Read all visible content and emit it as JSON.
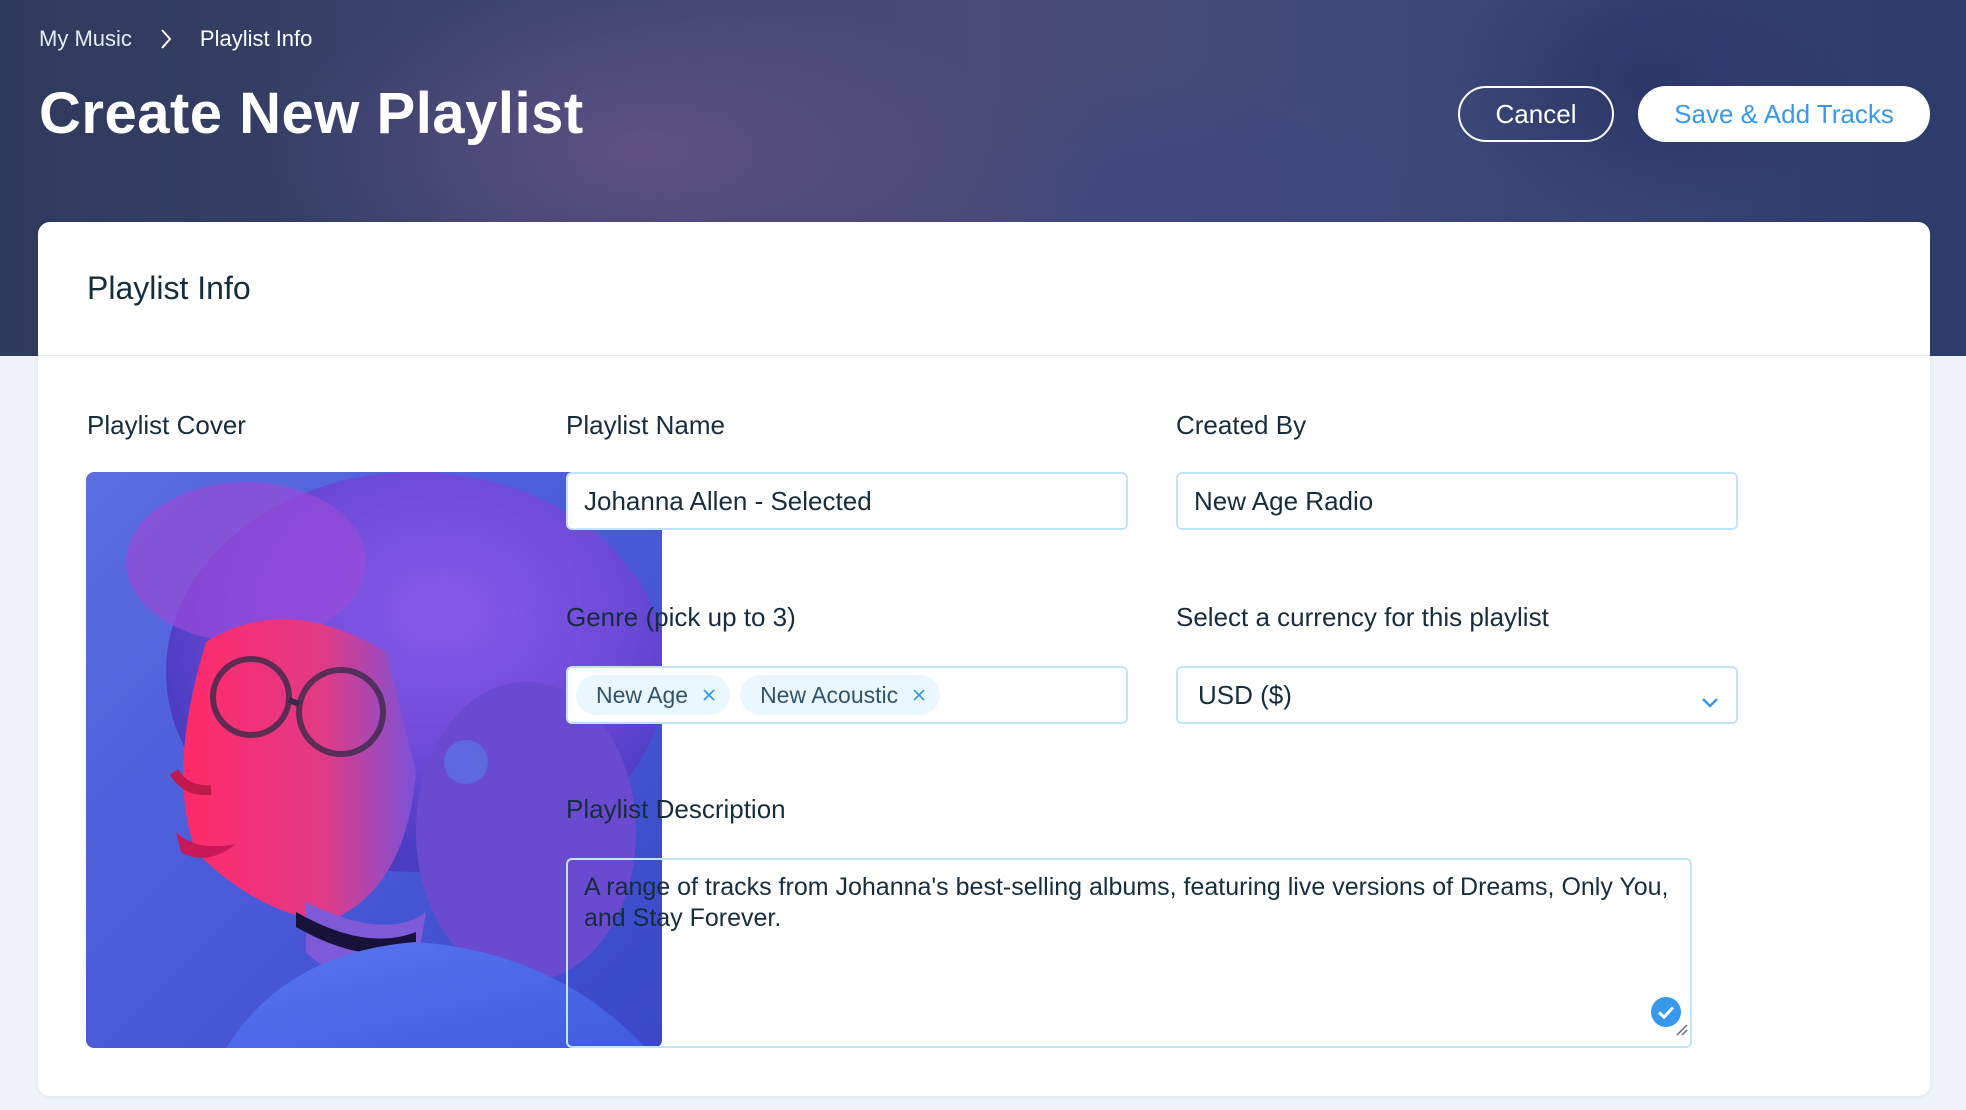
{
  "breadcrumb": {
    "parent": "My Music",
    "current": "Playlist Info",
    "separator_icon": "chevron-right-icon"
  },
  "header": {
    "title": "Create New Playlist",
    "cancel_label": "Cancel",
    "save_label": "Save & Add Tracks"
  },
  "card": {
    "title": "Playlist Info"
  },
  "form": {
    "cover": {
      "label": "Playlist Cover",
      "icon": "playlist-cover-image"
    },
    "playlist_name": {
      "label": "Playlist Name",
      "value": "Johanna Allen - Selected"
    },
    "created_by": {
      "label": "Created By",
      "value": "New Age Radio"
    },
    "genre": {
      "label": "Genre (pick up to 3)",
      "tags": [
        {
          "label": "New Age"
        },
        {
          "label": "New Acoustic"
        }
      ]
    },
    "currency": {
      "label": "Select a currency for this playlist",
      "value": "USD ($)"
    },
    "description": {
      "label": "Playlist Description",
      "value": "A range of tracks from Johanna's best-selling albums, featuring live versions of Dreams, Only You, and Stay Forever."
    }
  },
  "colors": {
    "accent": "#3899ec",
    "input_border": "#c1e4fe",
    "text": "#162d3d",
    "tag_bg": "#eaf7ff"
  }
}
